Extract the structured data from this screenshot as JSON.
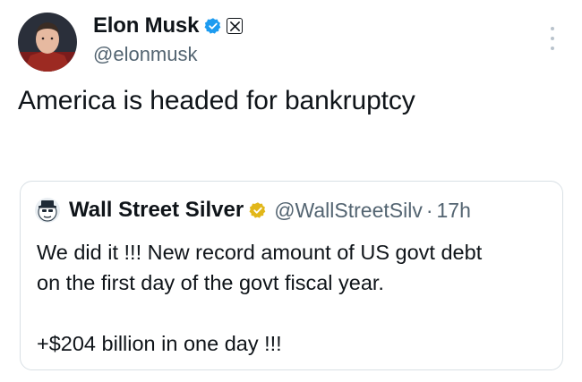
{
  "tweet": {
    "author": {
      "display_name": "Elon Musk",
      "handle": "@elonmusk",
      "verified_icon": "blue-verified-icon",
      "affiliate_badge_icon": "x-logo-icon"
    },
    "more_icon": "more-vertical-icon",
    "text": "America is headed for bankruptcy"
  },
  "quote": {
    "author": {
      "display_name": "Wall Street Silver",
      "handle": "@WallStreetSilv",
      "separator": "·",
      "time": "17h",
      "verified_icon": "gold-verified-icon"
    },
    "lines": [
      "We did it !!! New record amount of US govt debt",
      "on the first day of the govt fiscal year.",
      "+$204 billion in one day !!!"
    ]
  },
  "colors": {
    "text_primary": "#0f1419",
    "text_secondary": "#536471",
    "verified_blue": "#1d9bf0",
    "verified_gold": "#e2b719",
    "card_border": "#d9e0e5"
  }
}
